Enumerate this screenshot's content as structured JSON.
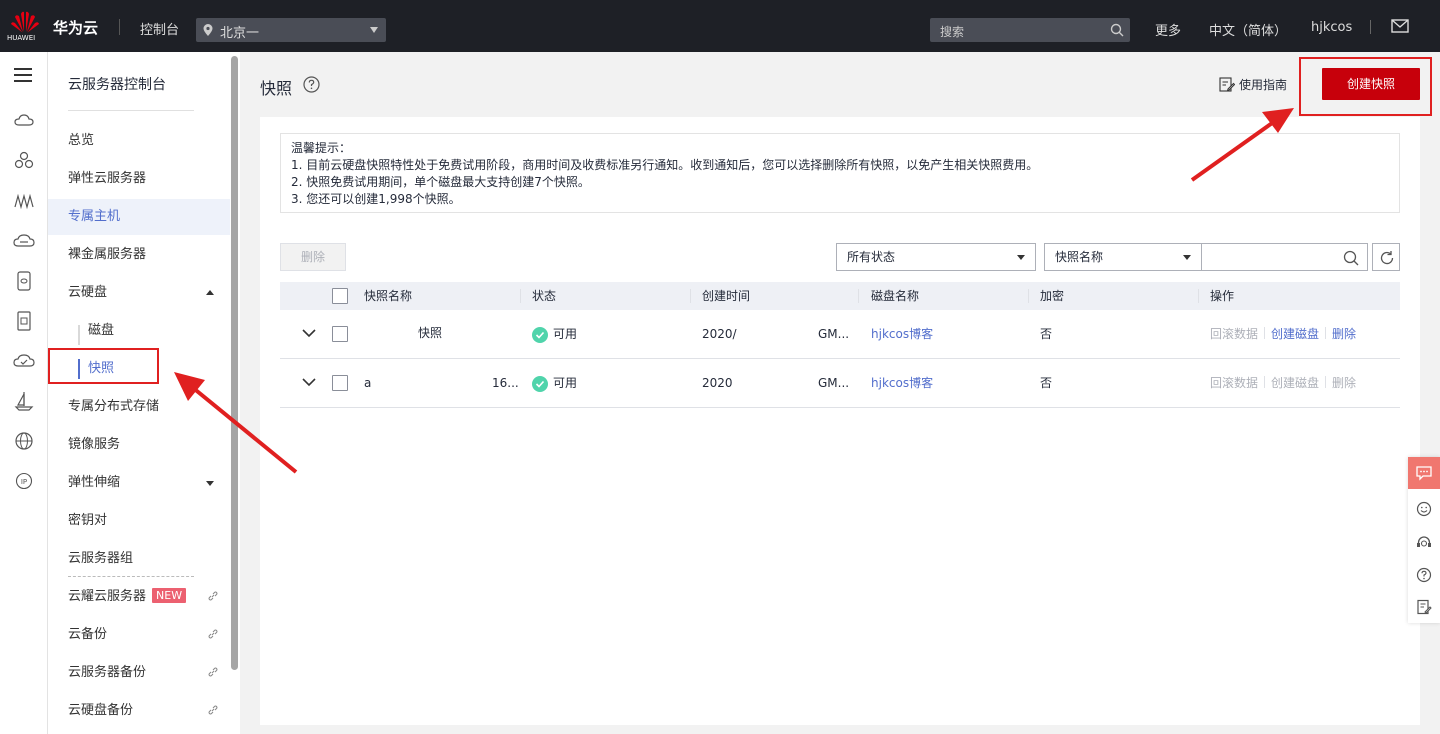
{
  "topbar": {
    "logo_text": "HUAWEI",
    "brand": "华为云",
    "console": "控制台",
    "region": "北京一",
    "search_placeholder": "搜索",
    "more": "更多",
    "language": "中文（简体）",
    "user": "hjkcos"
  },
  "sidebar": {
    "title": "云服务器控制台",
    "items": {
      "overview": "总览",
      "ecs": "弹性云服务器",
      "dedicated_host": "专属主机",
      "bms": "裸金属服务器",
      "evs": "云硬盘",
      "disk": "磁盘",
      "snapshot": "快照",
      "dss": "专属分布式存储",
      "ims": "镜像服务",
      "as": "弹性伸缩",
      "keypair": "密钥对",
      "server_group": "云服务器组",
      "cloud_phone": "云耀云服务器",
      "cbr": "云备份",
      "server_backup": "云服务器备份",
      "disk_backup": "云硬盘备份"
    },
    "new_badge": "NEW"
  },
  "header": {
    "title": "快照",
    "guide": "使用指南",
    "create_button": "创建快照"
  },
  "tips": {
    "title": "温馨提示：",
    "line1": "1. 目前云硬盘快照特性处于免费试用阶段，商用时间及收费标准另行通知。收到通知后，您可以选择删除所有快照，以免产生相关快照费用。",
    "line2": "2. 快照免费试用期间，单个磁盘最大支持创建7个快照。",
    "line3": "3. 您还可以创建1,998个快照。"
  },
  "toolbar": {
    "delete": "删除",
    "status_filter": "所有状态",
    "field_filter": "快照名称"
  },
  "table": {
    "columns": {
      "name": "快照名称",
      "status": "状态",
      "created": "创建时间",
      "disk": "磁盘名称",
      "encrypted": "加密",
      "actions": "操作"
    },
    "rows": [
      {
        "name": "快照",
        "status": "可用",
        "created_start": "2020/",
        "created_end": "GM...",
        "disk": "hjkcos博客",
        "encrypted": "否",
        "act_rollback": "回滚数据",
        "act_create_disk": "创建磁盘",
        "act_delete": "删除"
      },
      {
        "name_start": "a",
        "name_end": "16...",
        "status": "可用",
        "created_start": "2020",
        "created_end": "GM...",
        "disk": "hjkcos博客",
        "encrypted": "否",
        "act_rollback": "回滚数据",
        "act_create_disk": "创建磁盘",
        "act_delete": "删除"
      }
    ]
  },
  "colors": {
    "brand_red": "#c7000b",
    "link_blue": "#526ecc",
    "status_green": "#50d4ab",
    "annotation_red": "#e02020"
  }
}
